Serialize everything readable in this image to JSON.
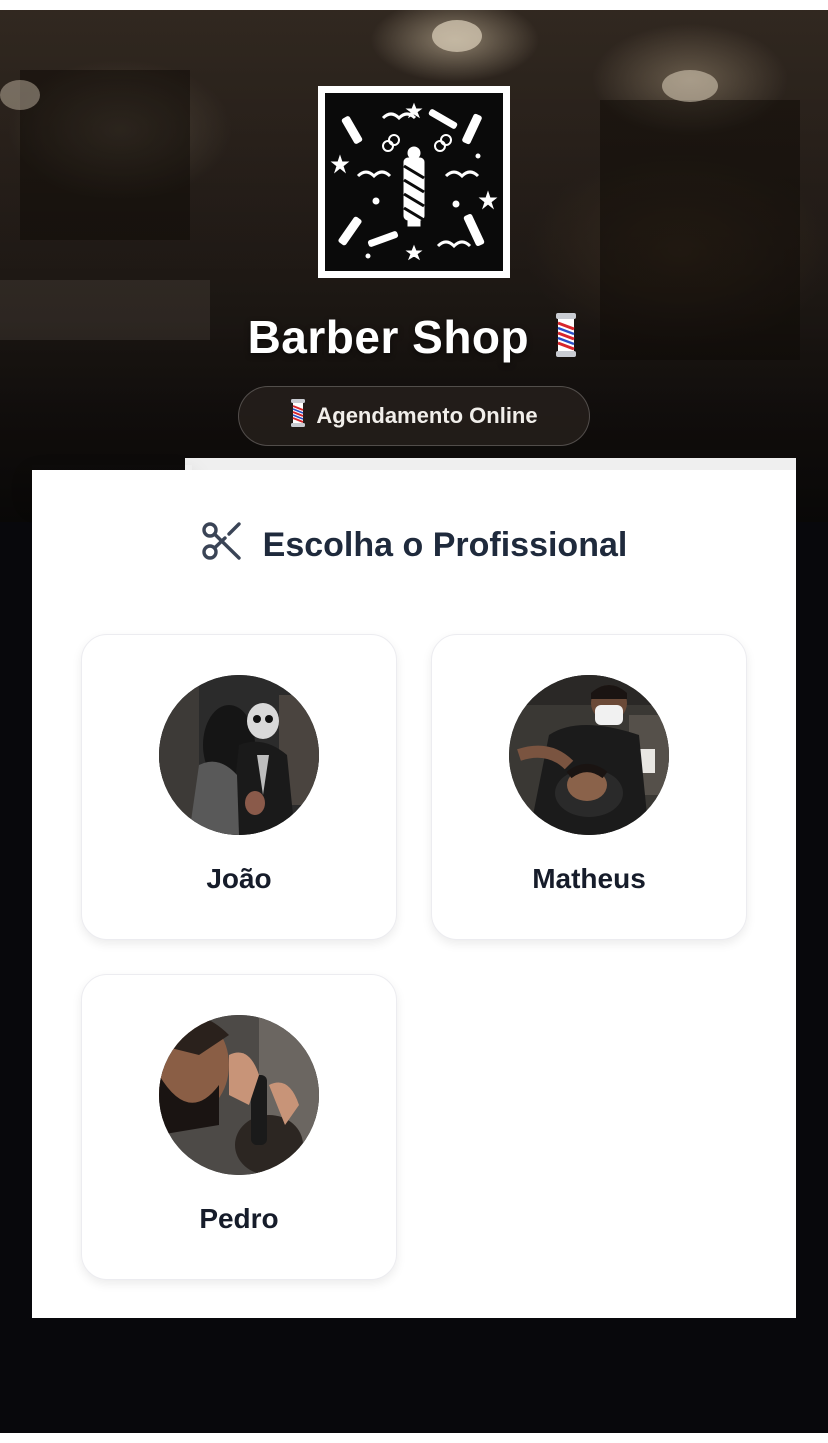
{
  "header": {
    "shop_name": "Barber Shop",
    "badge_label": "Agendamento Online",
    "logo_icon": "barber-pattern-logo",
    "pole_icon": "barber-pole-icon"
  },
  "section": {
    "title": "Escolha o Profissional",
    "icon": "scissors-icon"
  },
  "professionals": [
    {
      "name": "João"
    },
    {
      "name": "Matheus"
    },
    {
      "name": "Pedro"
    }
  ],
  "colors": {
    "title_text": "#1f2a3c",
    "name_text": "#161c2a",
    "page_bg": "#08080c",
    "card_bg": "#ffffff"
  }
}
